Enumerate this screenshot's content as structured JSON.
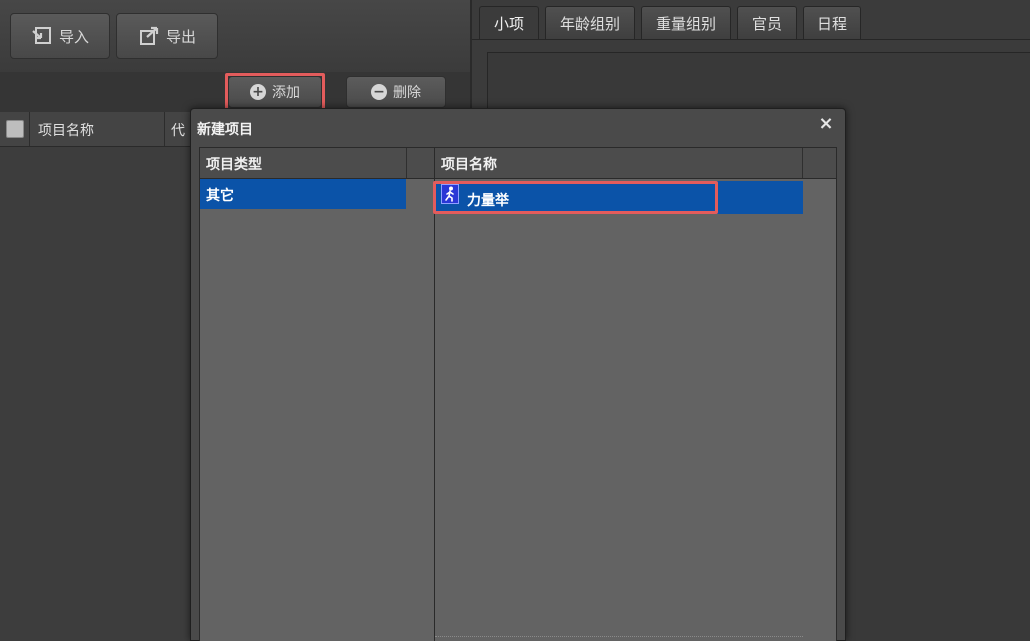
{
  "left_toolbar": {
    "import_label": "导入",
    "export_label": "导出"
  },
  "sub_toolbar": {
    "add_label": "添加",
    "delete_label": "删除"
  },
  "grid": {
    "columns": [
      "项目名称",
      "代"
    ]
  },
  "tabs": [
    {
      "label": "小项",
      "active": true
    },
    {
      "label": "年龄组别",
      "active": false
    },
    {
      "label": "重量组别",
      "active": false
    },
    {
      "label": "官员",
      "active": false
    },
    {
      "label": "日程",
      "active": false
    }
  ],
  "dialog": {
    "title": "新建项目",
    "close": "×",
    "type_list": {
      "header": "项目类型",
      "items": [
        "其它"
      ]
    },
    "name_list": {
      "header": "项目名称",
      "items": [
        {
          "label": "力量举",
          "icon": "runner-icon"
        }
      ]
    }
  },
  "colors": {
    "highlight": "#e35c5c",
    "selection": "#0b53a8"
  }
}
